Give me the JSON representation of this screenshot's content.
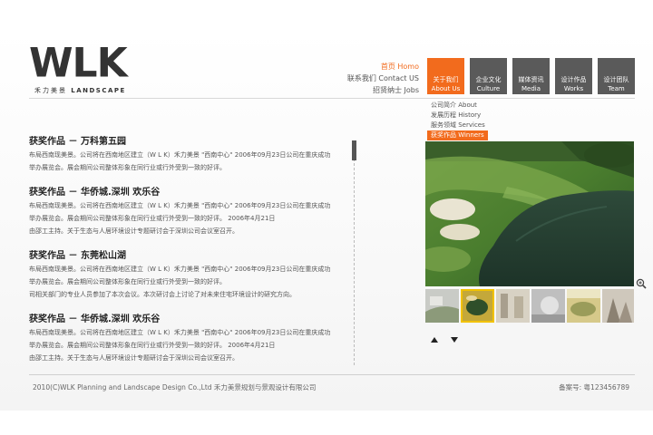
{
  "logo": {
    "wordmark": "WLK",
    "tagline_cn": "禾力美景",
    "tagline_en": "LANDSCAPE"
  },
  "quick_links": [
    {
      "label": "首页 Homo",
      "active": true
    },
    {
      "label": "联系我们 Contact US",
      "active": false
    },
    {
      "label": "招贤纳士 Jobs",
      "active": false
    }
  ],
  "nav": [
    {
      "cn": "关于我们",
      "en": "About Us",
      "active": true
    },
    {
      "cn": "企业文化",
      "en": "Culture",
      "active": false
    },
    {
      "cn": "媒体资讯",
      "en": "Media",
      "active": false
    },
    {
      "cn": "设计作品",
      "en": "Works",
      "active": false
    },
    {
      "cn": "设计团队",
      "en": "Team",
      "active": false
    }
  ],
  "submenu": [
    {
      "label": "公司简介 About",
      "active": false
    },
    {
      "label": "发展历程 History",
      "active": false
    },
    {
      "label": "服务领域 Services",
      "active": false
    },
    {
      "label": "获奖作品 Winners",
      "active": true
    }
  ],
  "articles": [
    {
      "title": "获奖作品 － 万科第五园",
      "lines": [
        "布局西南现美景。公司将在西南地区建立（W L K）禾力美景 \"西南中心\" 2006年09月23日公司在重庆成功",
        "举办展览会。展会期间公司整体形象在同行业或行外受到一致的好评。"
      ]
    },
    {
      "title": "获奖作品 － 华侨城.深圳 欢乐谷",
      "lines": [
        "布局西南现美景。公司将在西南地区建立（W L K）禾力美景 \"西南中心\" 2006年09月23日公司在重庆成功",
        "举办展览会。展会期间公司整体形象在同行业或行外受到一致的好评。 2006年4月21日",
        "由邵工主持。关于生态与人居环境设计专题研讨会于深圳公司会议室召开。"
      ]
    },
    {
      "title": "获奖作品 － 东莞松山湖",
      "lines": [
        "布局西南现美景。公司将在西南地区建立（W L K）禾力美景 \"西南中心\" 2006年09月23日公司在重庆成功",
        "举办展览会。展会期间公司整体形象在同行业或行外受到一致的好评。",
        "司相关部门的专业人员参加了本次会议。本次研讨会上讨论了对未来住宅环境设计的研究方向。"
      ]
    },
    {
      "title": "获奖作品 － 华侨城.深圳 欢乐谷",
      "lines": [
        "布局西南现美景。公司将在西南地区建立（W L K）禾力美景 \"西南中心\" 2006年09月23日公司在重庆成功",
        "举办展览会。展会期间公司整体形象在同行业或行外受到一致的好评。 2006年4月21日",
        "由邵工主持。关于生态与人居环境设计专题研讨会于深圳公司会议室召开。"
      ]
    }
  ],
  "gallery": {
    "thumb_colors": [
      "#c9cbc6",
      "#c4a83a",
      "#d8d2c4",
      "#bfbfbf",
      "#d6c98a",
      "#cfc8bc"
    ],
    "selected_index": 1
  },
  "icons": {
    "zoom": "zoom-in-icon",
    "prev": "arrow-up-icon",
    "next": "arrow-down-icon"
  },
  "footer": {
    "copyright": "2010(C)WLK Planning and Landscape Design Co.,Ltd  禾力美景规划与景观设计有限公司",
    "icp": "备案号: 粤123456789"
  },
  "colors": {
    "accent": "#f26b1d",
    "nav_bg": "#5a5a5a"
  }
}
